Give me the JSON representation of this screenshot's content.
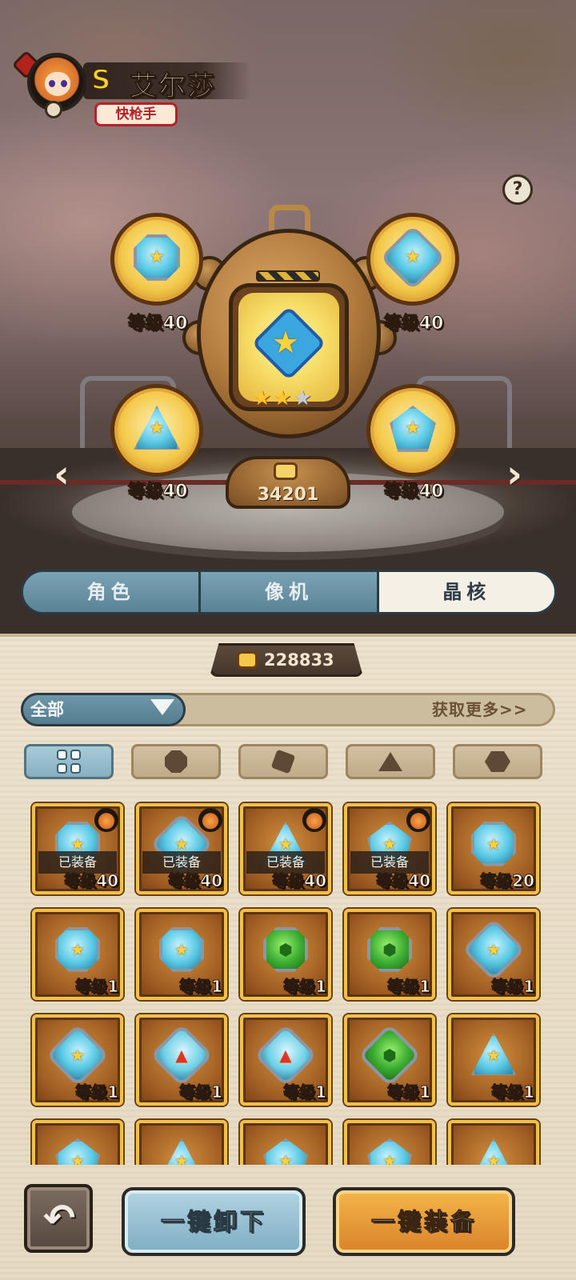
{
  "hero": {
    "rank": "S",
    "name": "艾尔莎",
    "class_tag": "快枪手"
  },
  "help": {
    "label": "?"
  },
  "machine": {
    "power_score": "34201",
    "stars": {
      "filled": 2,
      "total": 3
    }
  },
  "slots": [
    {
      "id": "top-left",
      "shape": "octagon",
      "level_label": "等级40"
    },
    {
      "id": "top-right",
      "shape": "diamond",
      "level_label": "等级40"
    },
    {
      "id": "bottom-left",
      "shape": "triangle",
      "level_label": "等级40"
    },
    {
      "id": "bottom-right",
      "shape": "pentagon",
      "level_label": "等级40"
    }
  ],
  "nav": {
    "prev": "‹",
    "next": "›"
  },
  "tabs": [
    {
      "label": "角色",
      "active": false
    },
    {
      "label": "像机",
      "active": false
    },
    {
      "label": "晶核",
      "active": true
    }
  ],
  "currency": {
    "icon": "fist-coin-icon",
    "value": "228833"
  },
  "filter": {
    "selected": "全部",
    "get_more": "获取更多>>"
  },
  "shape_filters": [
    {
      "name": "all-shapes",
      "active": true
    },
    {
      "name": "octagon",
      "active": false
    },
    {
      "name": "diamond",
      "active": false
    },
    {
      "name": "triangle",
      "active": false
    },
    {
      "name": "pentagon",
      "active": false
    }
  ],
  "inventory": [
    {
      "shape": "octagon",
      "color": "blue",
      "level": "等级40",
      "equipped": "已装备"
    },
    {
      "shape": "diamond",
      "color": "blue",
      "level": "等级40",
      "equipped": "已装备"
    },
    {
      "shape": "triangle",
      "color": "blue",
      "level": "等级40",
      "equipped": "已装备"
    },
    {
      "shape": "pentagon",
      "color": "blue",
      "level": "等级40",
      "equipped": "已装备"
    },
    {
      "shape": "octagon",
      "color": "blue",
      "level": "等级20",
      "equipped": ""
    },
    {
      "shape": "octagon",
      "color": "blue",
      "level": "等级1",
      "equipped": ""
    },
    {
      "shape": "octagon",
      "color": "blue",
      "level": "等级1",
      "equipped": ""
    },
    {
      "shape": "octagon",
      "color": "green",
      "level": "等级1",
      "equipped": ""
    },
    {
      "shape": "octagon",
      "color": "green",
      "level": "等级1",
      "equipped": ""
    },
    {
      "shape": "diamond",
      "color": "blue",
      "level": "等级1",
      "equipped": ""
    },
    {
      "shape": "diamond",
      "color": "blue",
      "level": "等级1",
      "equipped": ""
    },
    {
      "shape": "diamond",
      "color": "red",
      "level": "等级1",
      "equipped": ""
    },
    {
      "shape": "diamond",
      "color": "red",
      "level": "等级1",
      "equipped": ""
    },
    {
      "shape": "diamond",
      "color": "green",
      "level": "等级1",
      "equipped": ""
    },
    {
      "shape": "triangle",
      "color": "blue",
      "level": "等级1",
      "equipped": ""
    },
    {
      "shape": "pentagon",
      "color": "blue",
      "level": "",
      "equipped": ""
    },
    {
      "shape": "triangle",
      "color": "blue",
      "level": "",
      "equipped": ""
    },
    {
      "shape": "pentagon",
      "color": "blue",
      "level": "",
      "equipped": ""
    },
    {
      "shape": "pentagon",
      "color": "blue",
      "level": "",
      "equipped": ""
    },
    {
      "shape": "triangle",
      "color": "blue",
      "level": "",
      "equipped": ""
    }
  ],
  "buttons": {
    "back": "↶",
    "unequip_all": "一键卸下",
    "equip_all": "一键装备"
  }
}
